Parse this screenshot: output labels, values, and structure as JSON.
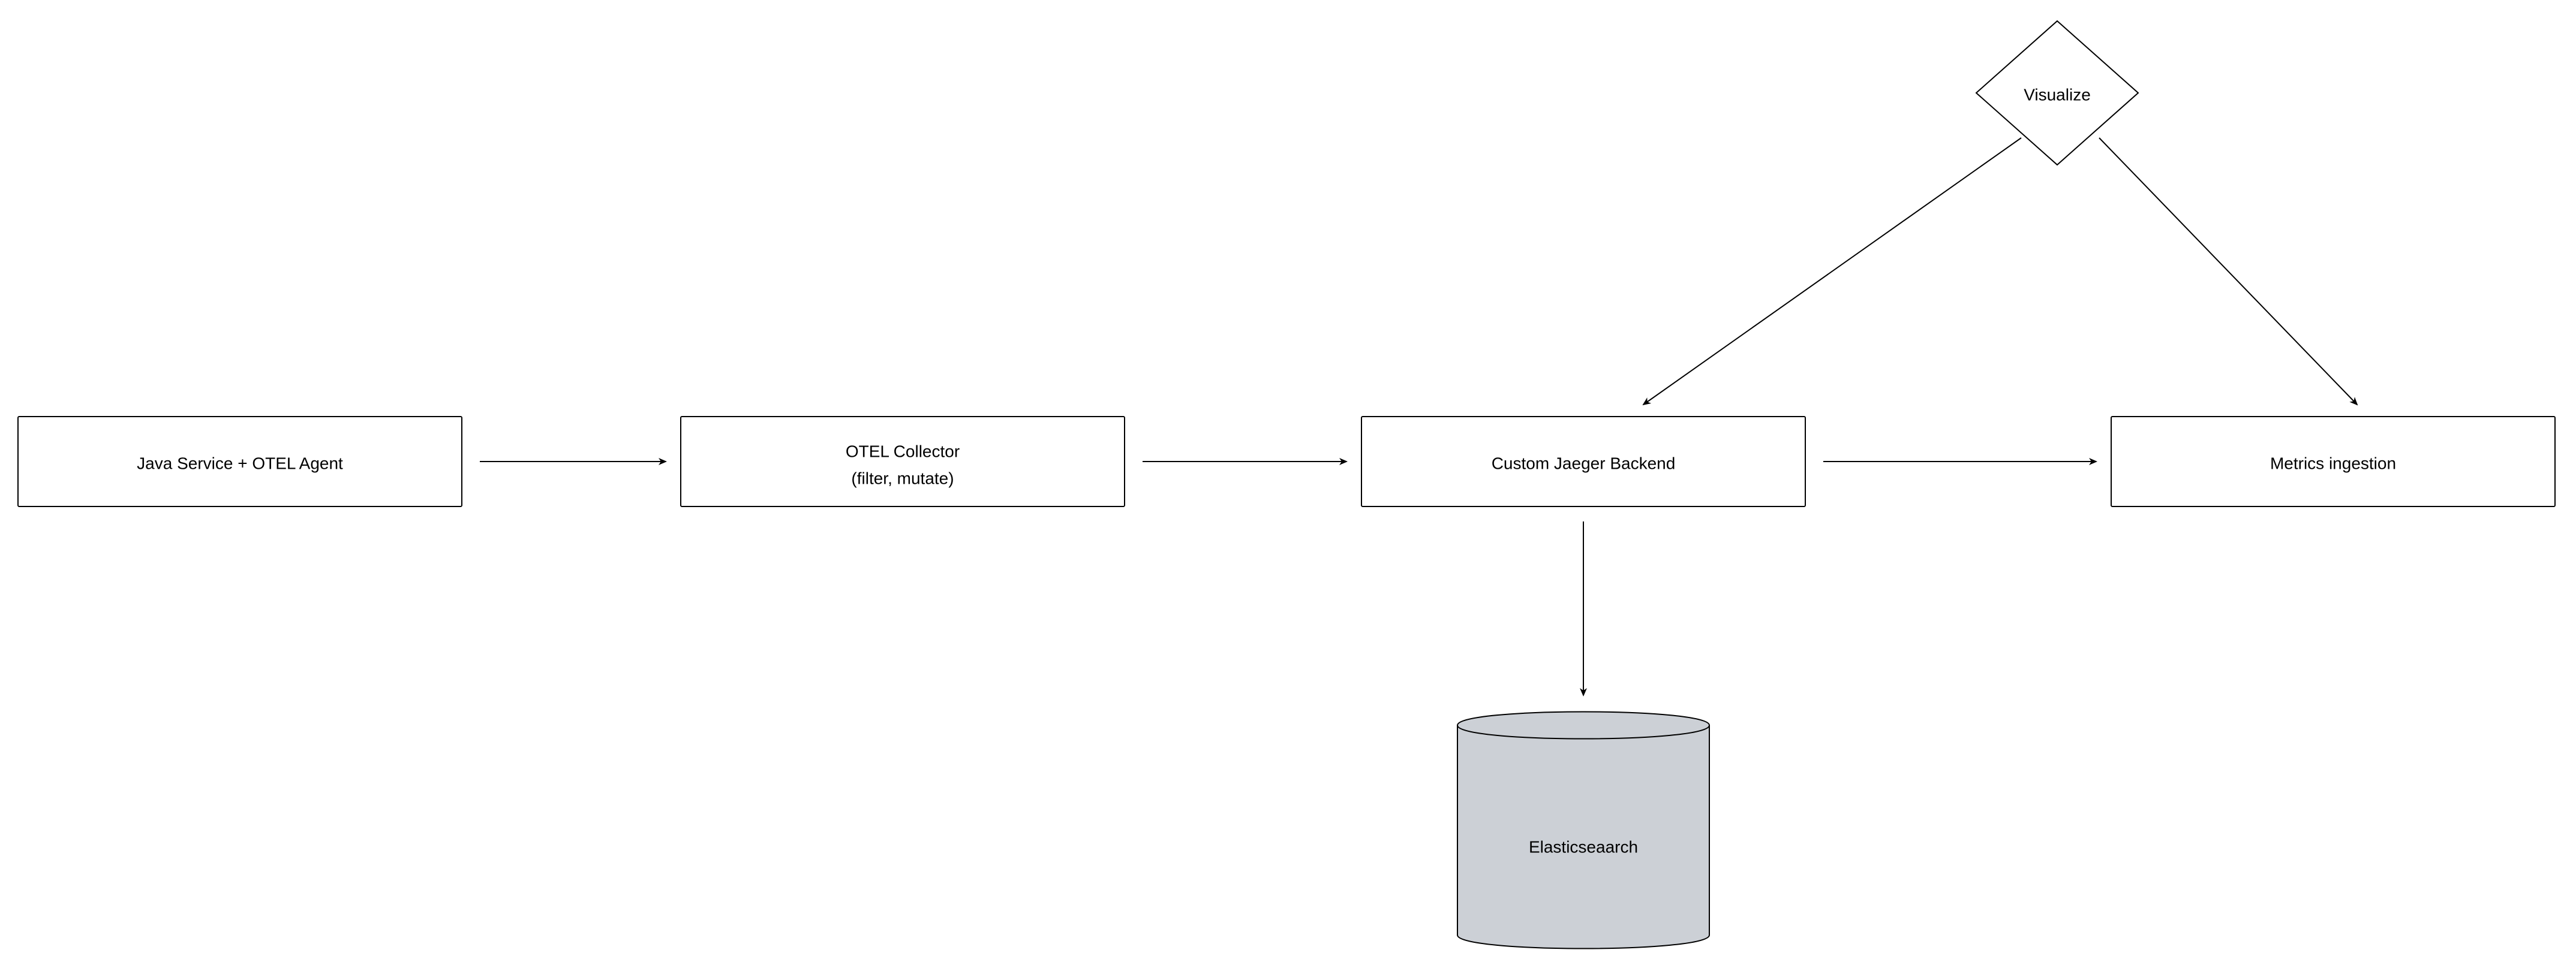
{
  "diagram": {
    "type": "architecture-flow",
    "nodes": {
      "java_service": {
        "label": "Java Service + OTEL Agent",
        "shape": "rect"
      },
      "otel_collector": {
        "label_line1": "OTEL Collector",
        "label_line2": "(filter, mutate)",
        "shape": "rect"
      },
      "jaeger_backend": {
        "label": "Custom Jaeger Backend",
        "shape": "rect"
      },
      "metrics_ingestion": {
        "label": "Metrics ingestion",
        "shape": "rect"
      },
      "visualize": {
        "label": "Visualize",
        "shape": "diamond"
      },
      "elasticsearch": {
        "label": "Elasticseaarch",
        "shape": "cylinder"
      }
    },
    "edges": [
      {
        "from": "java_service",
        "to": "otel_collector"
      },
      {
        "from": "otel_collector",
        "to": "jaeger_backend"
      },
      {
        "from": "jaeger_backend",
        "to": "metrics_ingestion"
      },
      {
        "from": "jaeger_backend",
        "to": "elasticsearch"
      },
      {
        "from": "visualize",
        "to": "jaeger_backend"
      },
      {
        "from": "visualize",
        "to": "metrics_ingestion"
      }
    ]
  }
}
